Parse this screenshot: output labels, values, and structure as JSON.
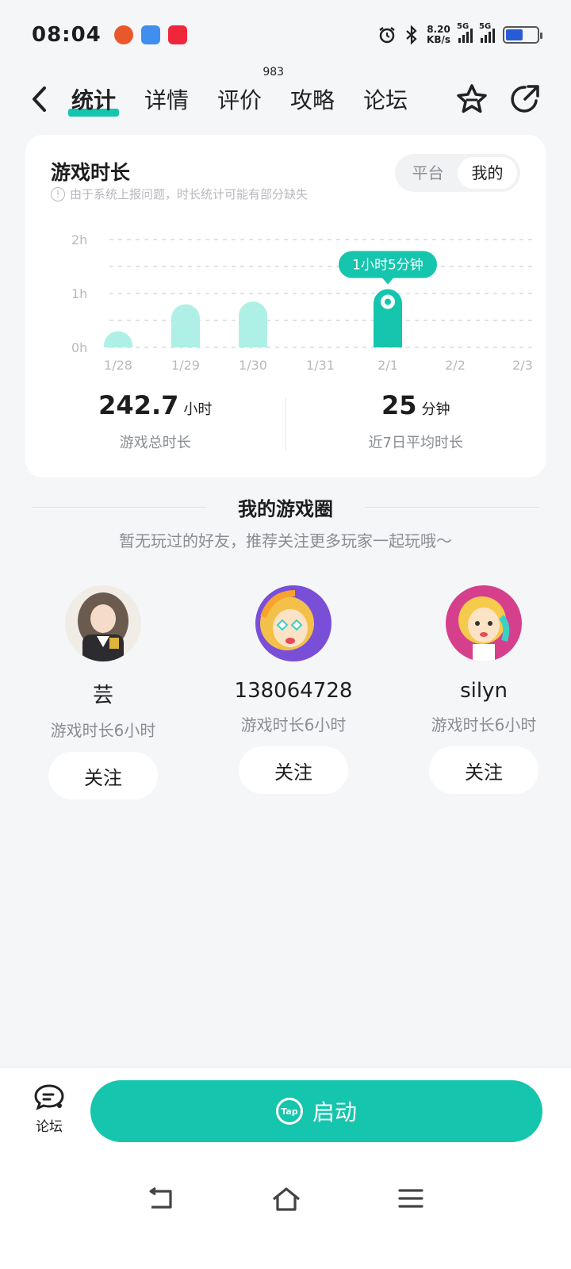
{
  "status": {
    "time": "08:04",
    "net_speed_value": "8.20",
    "net_speed_unit": "KB/s",
    "sig1": "5G",
    "sig2": "5G"
  },
  "nav": {
    "tabs": [
      {
        "label": "统计",
        "active": true
      },
      {
        "label": "详情"
      },
      {
        "label": "评价",
        "badge": "983"
      },
      {
        "label": "攻略"
      },
      {
        "label": "论坛"
      }
    ]
  },
  "stats": {
    "title": "游戏时长",
    "note": "由于系统上报问题，时长统计可能有部分缺失",
    "segment": {
      "options": [
        "平台",
        "我的"
      ],
      "selected": "我的"
    },
    "total_value": "242.7",
    "total_unit": "小时",
    "total_label": "游戏总时长",
    "avg_value": "25",
    "avg_unit": "分钟",
    "avg_label": "近7日平均时长"
  },
  "chart_data": {
    "type": "bar",
    "categories": [
      "1/28",
      "1/29",
      "1/30",
      "1/31",
      "2/1",
      "2/2",
      "2/3"
    ],
    "values": [
      0.3,
      0.8,
      0.85,
      0,
      1.08,
      0,
      0
    ],
    "y_ticks": [
      "0h",
      "1h",
      "2h"
    ],
    "ylim": [
      0,
      2
    ],
    "highlight_index": 4,
    "highlight_label": "1小时5分钟",
    "colors": {
      "bar": "#aef0e6",
      "highlight": "#15c5ad"
    }
  },
  "circle": {
    "title": "我的游戏圈",
    "subtitle": "暂无玩过的好友，推荐关注更多玩家一起玩哦～",
    "players": [
      {
        "name": "芸",
        "time": "游戏时长6小时",
        "follow": "关注"
      },
      {
        "name": "138064728",
        "time": "游戏时长6小时",
        "follow": "关注"
      },
      {
        "name": "silyn",
        "time": "游戏时长6小时",
        "follow": "关注"
      }
    ]
  },
  "bottom": {
    "forum_label": "论坛",
    "start_label": "启动",
    "tap_text": "Tap"
  },
  "colors": {
    "accent": "#15c5ad"
  }
}
